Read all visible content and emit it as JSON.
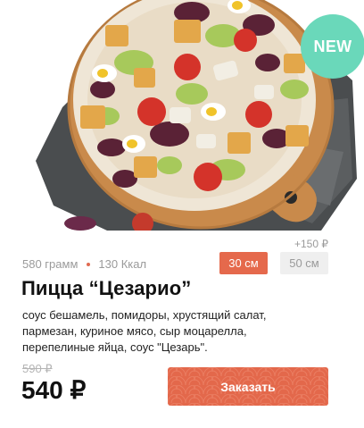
{
  "product": {
    "badge": "NEW",
    "weight": "580 грамм",
    "calories": "130 Ккал",
    "name": "Пицца “Цезарио”",
    "description": "соус бешамель, помидоры, хрустящий салат, пармезан, куриное мясо, сыр моцарелла, перепелиные яйца, соус \"Цезарь\".",
    "old_price": "590 ₽",
    "price": "540 ₽"
  },
  "sizes": {
    "extra_price": "+150 ₽",
    "options": [
      "30 см",
      "50 см"
    ],
    "selected": "30 см"
  },
  "actions": {
    "order_label": "Заказать"
  },
  "colors": {
    "accent": "#e5694c",
    "badge": "#6ad8ba"
  }
}
